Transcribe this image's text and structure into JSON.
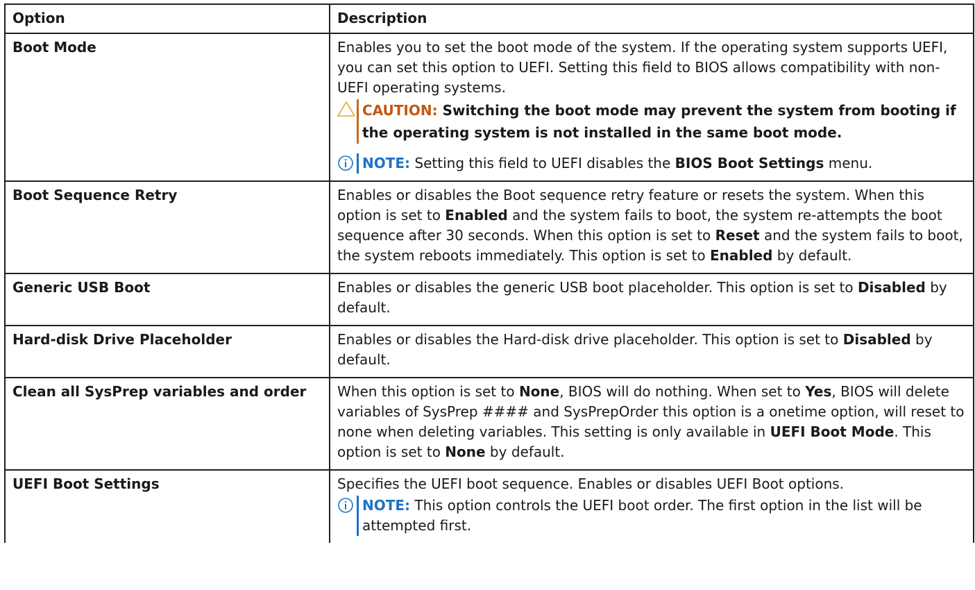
{
  "headers": {
    "option": "Option",
    "description": "Description"
  },
  "rows": {
    "boot_mode": {
      "option": "Boot Mode",
      "desc": "Enables you to set the boot mode of the system. If the operating system supports UEFI, you can set this option to UEFI. Setting this field to BIOS allows compatibility with non-UEFI operating systems.",
      "caution_label": "CAUTION:",
      "caution_text": " Switching the boot mode may prevent the system from booting if the operating system is not installed in the same boot mode.",
      "note_label": "NOTE:",
      "note_pre": " Setting this field to UEFI disables the ",
      "note_bold": "BIOS Boot Settings",
      "note_post": " menu."
    },
    "boot_sequence_retry": {
      "option": "Boot Sequence Retry",
      "t1": "Enables or disables the Boot sequence retry feature or resets the system. When this option is set to ",
      "b1": "Enabled",
      "t2": " and the system fails to boot, the system re-attempts the boot sequence after 30 seconds. When this option is set to ",
      "b2": "Reset",
      "t3": " and the system fails to boot, the system reboots immediately. This option is set to ",
      "b3": "Enabled",
      "t4": " by default."
    },
    "generic_usb_boot": {
      "option": "Generic USB Boot",
      "t1": "Enables or disables the generic USB boot placeholder. This option is set to ",
      "b1": "Disabled",
      "t2": " by default."
    },
    "hdd_placeholder": {
      "option": "Hard-disk Drive Placeholder",
      "t1": "Enables or disables the Hard-disk drive placeholder. This option is set to ",
      "b1": "Disabled",
      "t2": " by default."
    },
    "clean_sysprep": {
      "option": "Clean all SysPrep variables and order",
      "t1": "When this option is set to ",
      "b1": "None",
      "t2": ", BIOS will do nothing. When set to ",
      "b2": "Yes",
      "t3": ", BIOS will delete variables of SysPrep #### and SysPrepOrder this option is a onetime option, will reset to none when deleting variables. This setting is only available in ",
      "b3": "UEFI Boot Mode",
      "t4": ". This option is set to ",
      "b4": "None",
      "t5": " by default."
    },
    "uefi_boot_settings": {
      "option": "UEFI Boot Settings",
      "desc": "Specifies the UEFI boot sequence. Enables or disables UEFI Boot options.",
      "note_label": "NOTE:",
      "note_text": " This option controls the UEFI boot order. The first option in the list will be attempted first."
    }
  },
  "colors": {
    "caution": "#c05a12",
    "note": "#1f72c6",
    "border": "#1f1f1f"
  },
  "icons": {
    "caution": "caution-triangle-icon",
    "note": "info-circle-icon"
  }
}
